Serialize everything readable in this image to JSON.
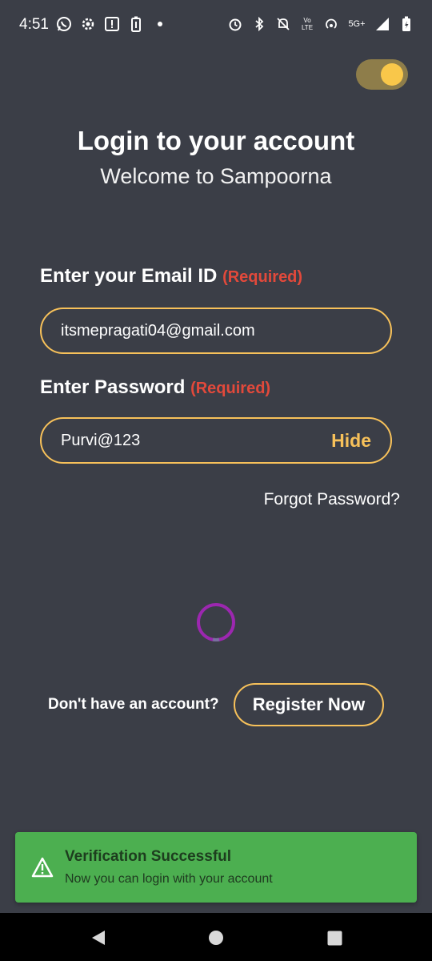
{
  "status_bar": {
    "time": "4:51",
    "left_icons": [
      "whatsapp-icon",
      "settings-icon",
      "info-box-icon",
      "battery-saver-icon",
      "dot-icon"
    ],
    "right_icons": [
      "alarm-icon",
      "bluetooth-icon",
      "notifications-off-icon",
      "volte-icon",
      "hotspot-icon",
      "5g-icon",
      "signal-icon",
      "battery-icon"
    ],
    "volte_text": "Vo LTE",
    "network_text": "5G+"
  },
  "theme_toggle": {
    "state": "on",
    "track_color": "#8e7d4a",
    "knob_color": "#f9c74a"
  },
  "header": {
    "title": "Login to your account",
    "subtitle": "Welcome to Sampoorna"
  },
  "email": {
    "label": "Enter your Email ID",
    "required": "(Required)",
    "value": "itsmepragati04@gmail.com"
  },
  "password": {
    "label": "Enter Password",
    "required": "(Required)",
    "value": "Purvi@123",
    "toggle_label": "Hide"
  },
  "forgot_password": "Forgot Password?",
  "register": {
    "prompt": "Don't have an account?",
    "button_label": "Register Now"
  },
  "toast": {
    "title": "Verification Successful",
    "message": "Now you can login with your account",
    "color": "#4caf50"
  },
  "colors": {
    "background": "#3b3e47",
    "accent": "#f7c15a",
    "required": "#e2493b",
    "spinner": "#9c27b0"
  }
}
